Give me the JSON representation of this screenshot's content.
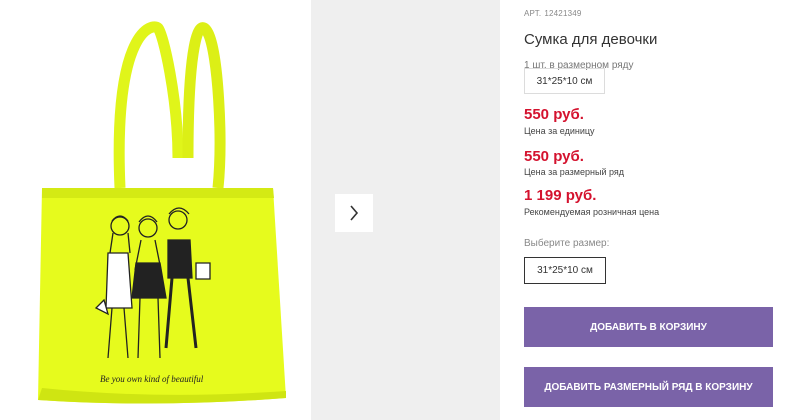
{
  "product": {
    "art_label": "АРТ.",
    "art_value": "12421349",
    "title": "Сумка для девочки",
    "qty_note": "1 шт. в размерном ряду",
    "size_chip": "31*25*10 см",
    "bag_slogan": "Be you own kind of beautiful",
    "bag_color": "#e6fb1d"
  },
  "prices": {
    "unit_price": "550 руб.",
    "unit_label": "Цена за единицу",
    "row_price": "550 руб.",
    "row_label": "Цена за размерный ряд",
    "retail_price": "1 199 руб.",
    "retail_label": "Рекомендуемая розничная цена",
    "accent_color": "#d4122e"
  },
  "size": {
    "choose_label": "Выберите размер:",
    "selected": "31*25*10 см"
  },
  "actions": {
    "add_to_cart": "ДОБАВИТЬ В КОРЗИНУ",
    "add_size_row": "ДОБАВИТЬ РАЗМЕРНЫЙ РЯД В КОРЗИНУ",
    "button_color": "#7a63a8"
  },
  "gallery": {
    "next_icon": "chevron-right-icon"
  }
}
